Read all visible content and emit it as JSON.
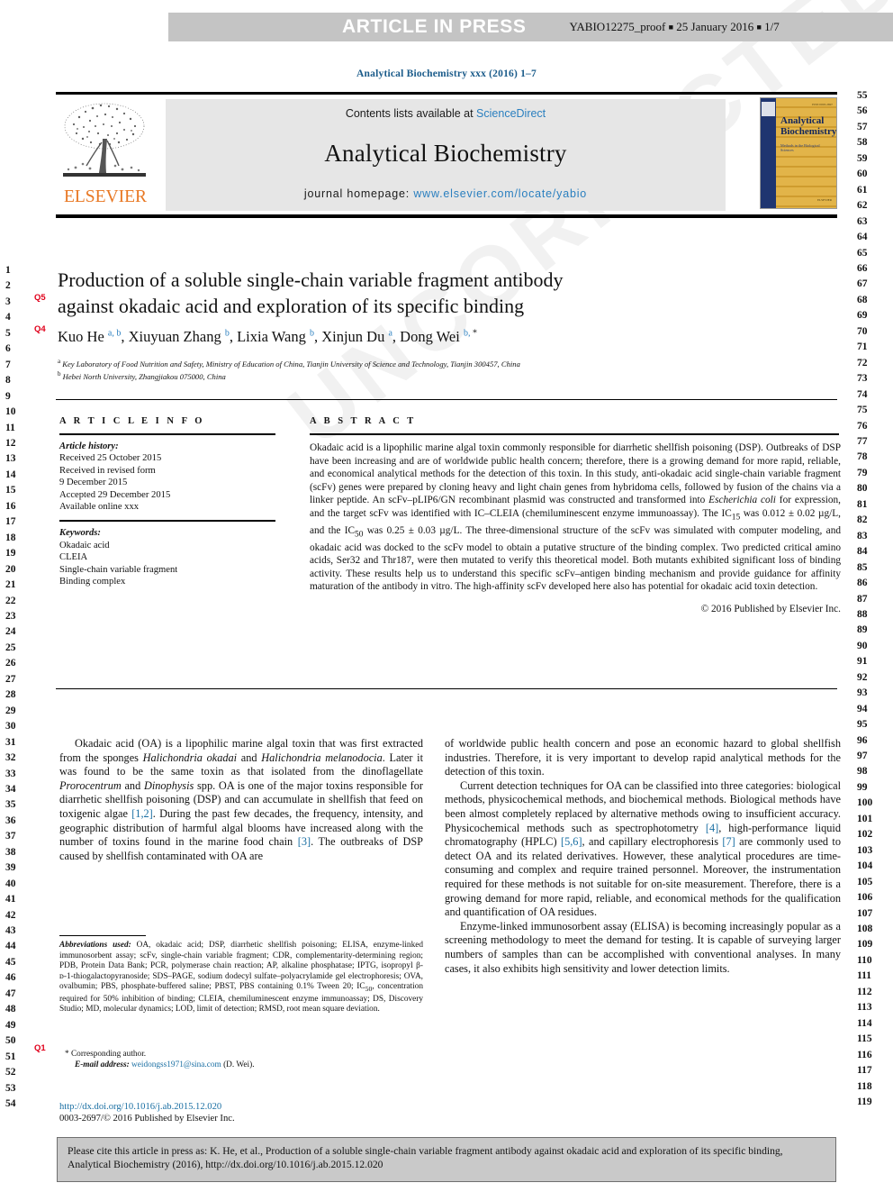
{
  "banner": {
    "label": "ARTICLE IN PRESS",
    "proof": "YABIO12275_proof",
    "date": "25 January 2016",
    "pages": "1/7",
    "bg_color": "#c4c4c4"
  },
  "running_head": "Analytical Biochemistry xxx (2016) 1–7",
  "masthead": {
    "contents_prefix": "Contents lists available at ",
    "contents_link": "ScienceDirect",
    "journal_name": "Analytical Biochemistry",
    "homepage_prefix": "journal homepage: ",
    "homepage_url": "www.elsevier.com/locate/yabio",
    "publisher": "ELSEVIER",
    "publisher_color": "#e87722",
    "link_color": "#2a7fbf",
    "cover": {
      "title_line1": "Analytical",
      "title_line2": "Biochemistry",
      "subtitle": "Methods in the Biological Sciences",
      "spine_color": "#1f3570",
      "body_color": "#d8a93b"
    }
  },
  "article": {
    "title_line1": "Production of a soluble single-chain variable fragment antibody",
    "title_line2": "against okadaic acid and exploration of its specific binding",
    "authors": [
      {
        "name": "Kuo He",
        "sup": "a, b"
      },
      {
        "name": "Xiuyuan Zhang",
        "sup": "b"
      },
      {
        "name": "Lixia Wang",
        "sup": "b"
      },
      {
        "name": "Xinjun Du",
        "sup": "a"
      },
      {
        "name": "Dong Wei",
        "sup": "b, *"
      }
    ],
    "affiliations": [
      {
        "marker": "a",
        "text": "Key Laboratory of Food Nutrition and Safety, Ministry of Education of China, Tianjin University of Science and Technology, Tianjin 300457, China"
      },
      {
        "marker": "b",
        "text": "Hebei North University, Zhangjiakou 075000, China"
      }
    ]
  },
  "info": {
    "heading": "A R T I C L E   I N F O",
    "history_label": "Article history:",
    "history": [
      "Received 25 October 2015",
      "Received in revised form",
      "9 December 2015",
      "Accepted 29 December 2015",
      "Available online xxx"
    ],
    "keywords_label": "Keywords:",
    "keywords": [
      "Okadaic acid",
      "CLEIA",
      "Single-chain variable fragment",
      "Binding complex"
    ]
  },
  "abstract": {
    "heading": "A B S T R A C T",
    "part1": "Okadaic acid is a lipophilic marine algal toxin commonly responsible for diarrhetic shellfish poisoning (DSP). Outbreaks of DSP have been increasing and are of worldwide public health concern; therefore, there is a growing demand for more rapid, reliable, and economical analytical methods for the detection of this toxin. In this study, anti-okadaic acid single-chain variable fragment (scFv) genes were prepared by cloning heavy and light chain genes from hybridoma cells, followed by fusion of the chains via a linker peptide. An scFv–pLIP6/GN recombinant plasmid was constructed and transformed into ",
    "italic1": "Escherichia coli",
    "part2": " for expression, and the target scFv was identified with IC–CLEIA (chemiluminescent enzyme immunoassay). The IC",
    "sub1": "15",
    "part3": " was 0.012 ± 0.02 µg/L, and the IC",
    "sub2": "50",
    "part4": " was 0.25 ± 0.03 µg/L. The three-dimensional structure of the scFv was simulated with computer modeling, and okadaic acid was docked to the scFv model to obtain a putative structure of the binding complex. Two predicted critical amino acids, Ser32 and Thr187, were then mutated to verify this theoretical model. Both mutants exhibited significant loss of binding activity. These results help us to understand this specific scFv–antigen binding mechanism and provide guidance for affinity maturation of the antibody in vitro. The high-affinity scFv developed here also has potential for okadaic acid toxin detection.",
    "copyright": "© 2016 Published by Elsevier Inc."
  },
  "body": {
    "left_paragraphs": [
      {
        "segments": [
          {
            "t": "Okadaic acid (OA) is a lipophilic marine algal toxin that was first extracted from the sponges ",
            "s": "n"
          },
          {
            "t": "Halichondria okadai",
            "s": "i"
          },
          {
            "t": " and ",
            "s": "n"
          },
          {
            "t": "Halichondria melanodocia",
            "s": "i"
          },
          {
            "t": ". Later it was found to be the same toxin as that isolated from the dinoflagellate ",
            "s": "n"
          },
          {
            "t": "Prorocentrum",
            "s": "i"
          },
          {
            "t": " and ",
            "s": "n"
          },
          {
            "t": "Dinophysis",
            "s": "i"
          },
          {
            "t": " spp. OA is one of the major toxins responsible for diarrhetic shellfish poisoning (DSP) and can accumulate in shellfish that feed on toxigenic algae ",
            "s": "n"
          },
          {
            "t": "[1,2]",
            "s": "r"
          },
          {
            "t": ". During the past few decades, the frequency, intensity, and geographic distribution of harmful algal blooms have increased along with the number of toxins found in the marine food chain ",
            "s": "n"
          },
          {
            "t": "[3]",
            "s": "r"
          },
          {
            "t": ". The outbreaks of DSP caused by shellfish contaminated with OA are",
            "s": "n"
          }
        ]
      }
    ],
    "right_paragraphs": [
      {
        "indent": false,
        "segments": [
          {
            "t": "of worldwide public health concern and pose an economic hazard to global shellfish industries. Therefore, it is very important to develop rapid analytical methods for the detection of this toxin.",
            "s": "n"
          }
        ]
      },
      {
        "indent": true,
        "segments": [
          {
            "t": "Current detection techniques for OA can be classified into three categories: biological methods, physicochemical methods, and biochemical methods. Biological methods have been almost completely replaced by alternative methods owing to insufficient accuracy. Physicochemical methods such as spectrophotometry ",
            "s": "n"
          },
          {
            "t": "[4]",
            "s": "r"
          },
          {
            "t": ", high-performance liquid chromatography (HPLC) ",
            "s": "n"
          },
          {
            "t": "[5,6]",
            "s": "r"
          },
          {
            "t": ", and capillary electrophoresis ",
            "s": "n"
          },
          {
            "t": "[7]",
            "s": "r"
          },
          {
            "t": " are commonly used to detect OA and its related derivatives. However, these analytical procedures are time-consuming and complex and require trained personnel. Moreover, the instrumentation required for these methods is not suitable for on-site measurement. Therefore, there is a growing demand for more rapid, reliable, and economical methods for the qualification and quantification of OA residues.",
            "s": "n"
          }
        ]
      },
      {
        "indent": true,
        "segments": [
          {
            "t": "Enzyme-linked immunosorbent assay (ELISA) is becoming increasingly popular as a screening methodology to meet the demand for testing. It is capable of surveying larger numbers of samples than can be accomplished with conventional analyses. In many cases, it also exhibits high sensitivity and lower detection limits.",
            "s": "n"
          }
        ]
      }
    ]
  },
  "footnote": {
    "lead": "Abbreviations used:",
    "text": " OA, okadaic acid; DSP, diarrhetic shellfish poisoning; ELISA, enzyme-linked immunosorbent assay; scFv, single-chain variable fragment; CDR, complementarity-determining region; PDB, Protein Data Bank; PCR, polymerase chain reaction; AP, alkaline phosphatase; IPTG, isopropyl β-ᴅ-1-thiogalactopyranoside; SDS–PAGE, sodium dodecyl sulfate–polyacrylamide gel electrophoresis; OVA, ovalbumin; PBS, phosphate-buffered saline; PBST, PBS containing 0.1% Tween 20; IC",
    "sub": "50",
    "text2": ", concentration required for 50% inhibition of binding; CLEIA, chemiluminescent enzyme immunoassay; DS, Discovery Studio; MD, molecular dynamics; LOD, limit of detection; RMSD, root mean square deviation.",
    "corresponding": "* Corresponding author.",
    "email_label": "E-mail address:",
    "email": "weidongss1971@sina.com",
    "email_suffix": " (D. Wei)."
  },
  "doi": {
    "url": "http://dx.doi.org/10.1016/j.ab.2015.12.020",
    "issn_line": "0003-2697/© 2016 Published by Elsevier Inc."
  },
  "cite_box": {
    "text": "Please cite this article in press as: K. He, et al., Production of a soluble single-chain variable fragment antibody against okadaic acid and exploration of its specific binding, Analytical Biochemistry (2016), http://dx.doi.org/10.1016/j.ab.2015.12.020"
  },
  "line_numbers": {
    "left_start": 1,
    "left_end": 54,
    "right_start": 55,
    "right_end": 119
  },
  "query_marks": [
    {
      "label": "Q5"
    },
    {
      "label": "Q4"
    },
    {
      "label": "Q1"
    }
  ],
  "watermark": "UNCORRECTED PROOF"
}
